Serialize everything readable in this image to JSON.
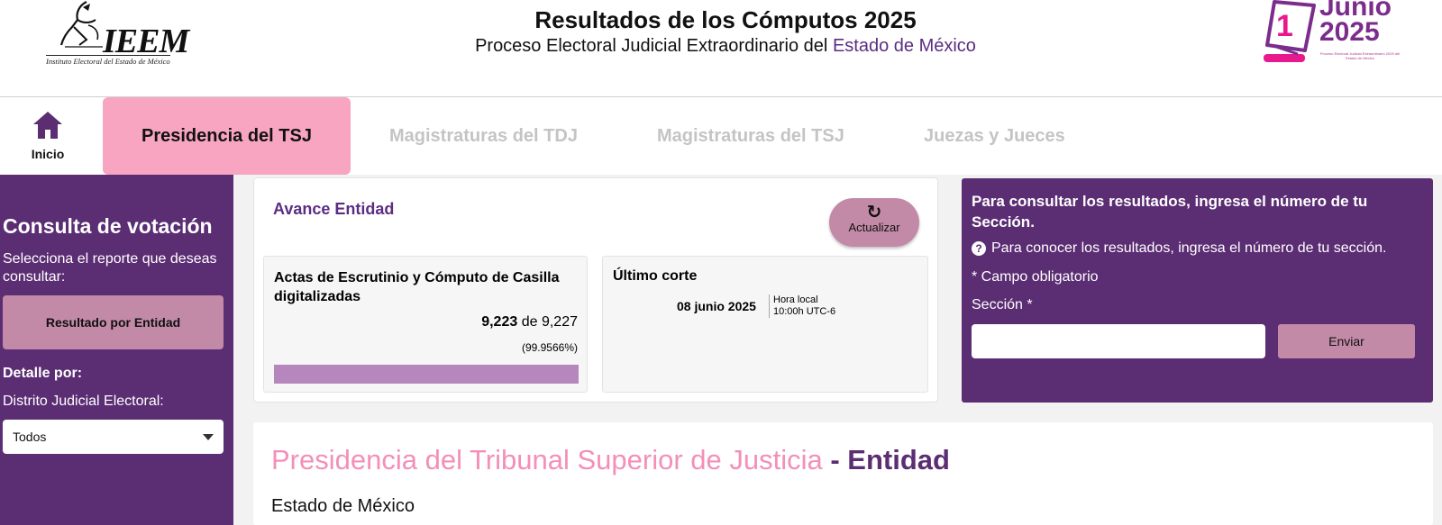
{
  "header": {
    "logo_left": {
      "name": "IEEM",
      "subtitle": "Instituto Electoral del Estado de México"
    },
    "title": "Resultados de los Cómputos 2025",
    "subtitle_prefix": "Proceso Electoral Judicial Extraordinario del",
    "subtitle_accent": "Estado de México",
    "logo_right": {
      "day": "1",
      "month": "Junio",
      "year": "2025",
      "small_text": "Proceso Electoral Judicial Extraordinario 2025 del Estado de México"
    }
  },
  "nav": {
    "home_label": "Inicio",
    "home_icon": "home-icon",
    "tabs": [
      {
        "label": "Presidencia del TSJ",
        "active": true
      },
      {
        "label": "Magistraturas del TDJ",
        "active": false
      },
      {
        "label": "Magistraturas del TSJ",
        "active": false
      },
      {
        "label": "Juezas y Jueces",
        "active": false
      }
    ]
  },
  "sidebar": {
    "title": "Consulta de votación",
    "description": "Selecciona el reporte que deseas consultar:",
    "report_button": "Resultado por Entidad",
    "detail_label": "Detalle por:",
    "district_label": "Distrito Judicial Electoral:",
    "district_selected": "Todos"
  },
  "avance": {
    "title": "Avance Entidad",
    "refresh_label": "Actualizar",
    "refresh_icon": "refresh-icon",
    "actas": {
      "title": "Actas de Escrutinio y Cómputo de Casilla digitalizadas",
      "count": "9,223",
      "connector": "de",
      "total": "9,227",
      "percent_text": "(99.9566%)",
      "progress_fraction": 0.999566
    },
    "corte": {
      "title": "Último corte",
      "date": "08 junio 2025",
      "time_label": "Hora local",
      "time_value": "10:00h UTC-6"
    }
  },
  "consulta": {
    "title": "Para consultar los resultados, ingresa el número de tu Sección.",
    "help_icon": "question-circle-icon",
    "help_text": "Para conocer los resultados, ingresa el número de tu sección.",
    "required_note": "* Campo obligatorio",
    "section_label": "Sección *",
    "section_value": "",
    "send_label": "Enviar"
  },
  "results": {
    "title_main": "Presidencia del Tribunal Superior de Justicia",
    "title_suffix": "- Entidad",
    "subtitle": "Estado de México"
  },
  "colors": {
    "purple": "#5b2d73",
    "pink_tab": "#f8a5c2",
    "mauve": "#c38aa8",
    "progress_fill": "#b687bc",
    "pink_title": "#f48fb8"
  }
}
